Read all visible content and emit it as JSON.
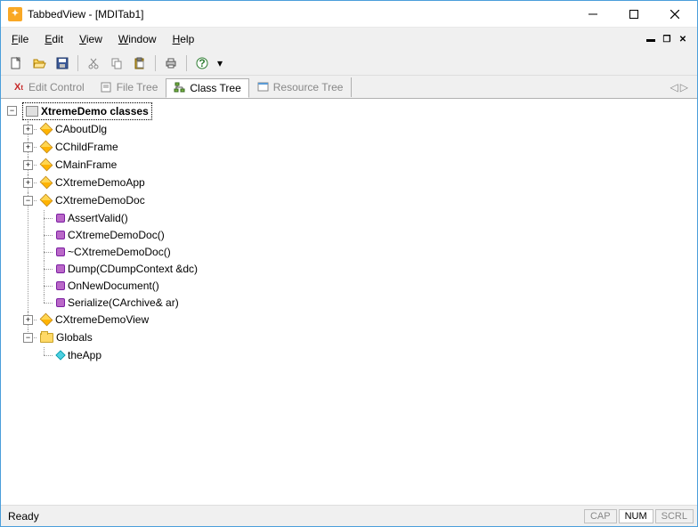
{
  "window": {
    "title": "TabbedView - [MDITab1]"
  },
  "menu": {
    "file": "File",
    "edit": "Edit",
    "view": "View",
    "window": "Window",
    "help": "Help"
  },
  "tabs": {
    "edit_control": "Edit Control",
    "file_tree": "File Tree",
    "class_tree": "Class Tree",
    "resource_tree": "Resource Tree"
  },
  "tree": {
    "root": "XtremeDemo classes",
    "c1": "CAboutDlg",
    "c2": "CChildFrame",
    "c3": "CMainFrame",
    "c4": "CXtremeDemoApp",
    "c5": "CXtremeDemoDoc",
    "m1": "AssertValid()",
    "m2": "CXtremeDemoDoc()",
    "m3": "~CXtremeDemoDoc()",
    "m4": "Dump(CDumpContext &dc)",
    "m5": "OnNewDocument()",
    "m6": "Serialize(CArchive& ar)",
    "c6": "CXtremeDemoView",
    "globals": "Globals",
    "g1": "theApp"
  },
  "status": {
    "ready": "Ready",
    "cap": "CAP",
    "num": "NUM",
    "scrl": "SCRL"
  }
}
